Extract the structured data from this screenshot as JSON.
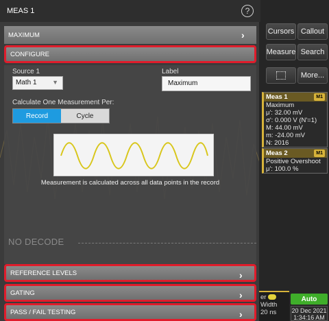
{
  "dialog": {
    "title": "MEAS 1",
    "sections": {
      "maximum": "MAXIMUM",
      "configure": "CONFIGURE",
      "reference_levels": "REFERENCE LEVELS",
      "gating": "GATING",
      "pass_fail": "PASS / FAIL TESTING"
    },
    "configure": {
      "source_label": "Source 1",
      "source_value": "Math 1",
      "label_label": "Label",
      "label_value": "Maximum",
      "calc_label": "Calculate One Measurement Per:",
      "toggle_record": "Record",
      "toggle_cycle": "Cycle",
      "selected": "Record",
      "caption": "Measurement is calculated across all data points in the record"
    },
    "no_decode": "NO DECODE"
  },
  "right_panel": {
    "buttons": [
      "Cursors",
      "Callout",
      "Measure",
      "Search",
      "More..."
    ],
    "meas1": {
      "title": "Meas 1",
      "tag": "M1",
      "lines": [
        "Maximum",
        "μ': 32.00 mV",
        "σ': 0.000 V (N'=1)",
        "M: 44.00 mV",
        "m: -24.00 mV",
        "N: 2016"
      ]
    },
    "meas2": {
      "title": "Meas 2",
      "tag": "M1",
      "lines": [
        "Positive Overshoot",
        "μ': 100.0 %"
      ]
    },
    "channel_tab": {
      "top": "er",
      "line2": "Width",
      "line3": "20 ns"
    },
    "auto_label": "Auto",
    "date": "20 Dec 2021",
    "time": "1:34:16 AM"
  },
  "colors": {
    "highlight": "#e01c2b",
    "accent_blue": "#1e9be0",
    "waveform": "#d8c61a",
    "meas_accent": "#d7b33a",
    "auto_green": "#3fae2a"
  }
}
